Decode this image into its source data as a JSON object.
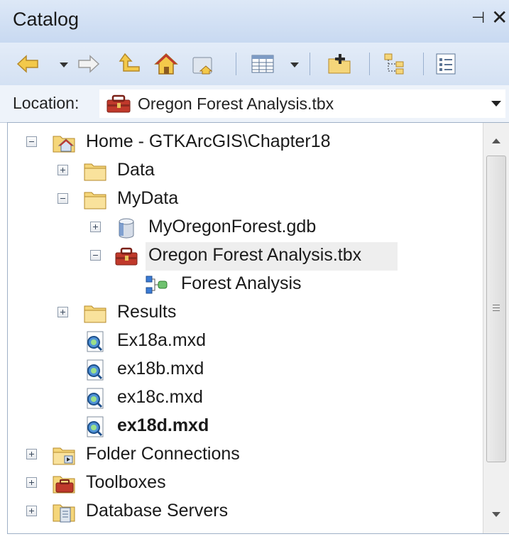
{
  "window": {
    "title": "Catalog",
    "pin_icon": "pin-icon",
    "close_icon": "close-icon"
  },
  "toolbar": {
    "buttons": [
      {
        "name": "back",
        "icon": "back-arrow-icon"
      },
      {
        "name": "back-dropdown",
        "icon": "chevron-down-icon"
      },
      {
        "name": "forward",
        "icon": "forward-arrow-icon"
      },
      {
        "name": "up-one-level",
        "icon": "up-level-icon"
      },
      {
        "name": "home",
        "icon": "home-icon"
      },
      {
        "name": "connect-to-folder",
        "icon": "connect-folder-icon"
      },
      {
        "name": "view-options",
        "icon": "table-view-icon"
      },
      {
        "name": "view-dropdown",
        "icon": "chevron-down-icon"
      },
      {
        "name": "new-item",
        "icon": "new-folder-icon"
      },
      {
        "name": "toggle-contents",
        "icon": "tree-view-icon"
      },
      {
        "name": "options",
        "icon": "list-options-icon"
      }
    ]
  },
  "location": {
    "label": "Location:",
    "value": "Oregon Forest Analysis.tbx"
  },
  "tree": {
    "items": [
      {
        "label": "Home - GTKArcGIS\\Chapter18",
        "icon": "home-folder-icon",
        "state": "expanded",
        "level": 0
      },
      {
        "label": "Data",
        "icon": "folder-icon",
        "state": "collapsed",
        "level": 1
      },
      {
        "label": "MyData",
        "icon": "folder-icon",
        "state": "expanded",
        "level": 1
      },
      {
        "label": "MyOregonForest.gdb",
        "icon": "geodatabase-icon",
        "state": "collapsed",
        "level": 2
      },
      {
        "label": "Oregon Forest Analysis.tbx",
        "icon": "toolbox-icon",
        "state": "expanded",
        "level": 2,
        "selected": true
      },
      {
        "label": "Forest Analysis",
        "icon": "model-icon",
        "state": "leaf",
        "level": 3
      },
      {
        "label": "Results",
        "icon": "folder-icon",
        "state": "collapsed",
        "level": 1
      },
      {
        "label": "Ex18a.mxd",
        "icon": "map-document-icon",
        "state": "leaf",
        "level": 1
      },
      {
        "label": "ex18b.mxd",
        "icon": "map-document-icon",
        "state": "leaf",
        "level": 1
      },
      {
        "label": "ex18c.mxd",
        "icon": "map-document-icon",
        "state": "leaf",
        "level": 1
      },
      {
        "label": "ex18d.mxd",
        "icon": "map-document-icon",
        "state": "leaf",
        "level": 1,
        "bold": true
      },
      {
        "label": "Folder Connections",
        "icon": "folder-connections-icon",
        "state": "collapsed",
        "level": 0
      },
      {
        "label": "Toolboxes",
        "icon": "toolboxes-icon",
        "state": "collapsed",
        "level": 0
      },
      {
        "label": "Database Servers",
        "icon": "database-servers-icon",
        "state": "collapsed",
        "level": 0
      }
    ]
  },
  "colors": {
    "titlebar": "#c8d9f1",
    "toolbar": "#d4e1f3",
    "folder": "#f5d67a",
    "toolbox": "#c0392b"
  }
}
